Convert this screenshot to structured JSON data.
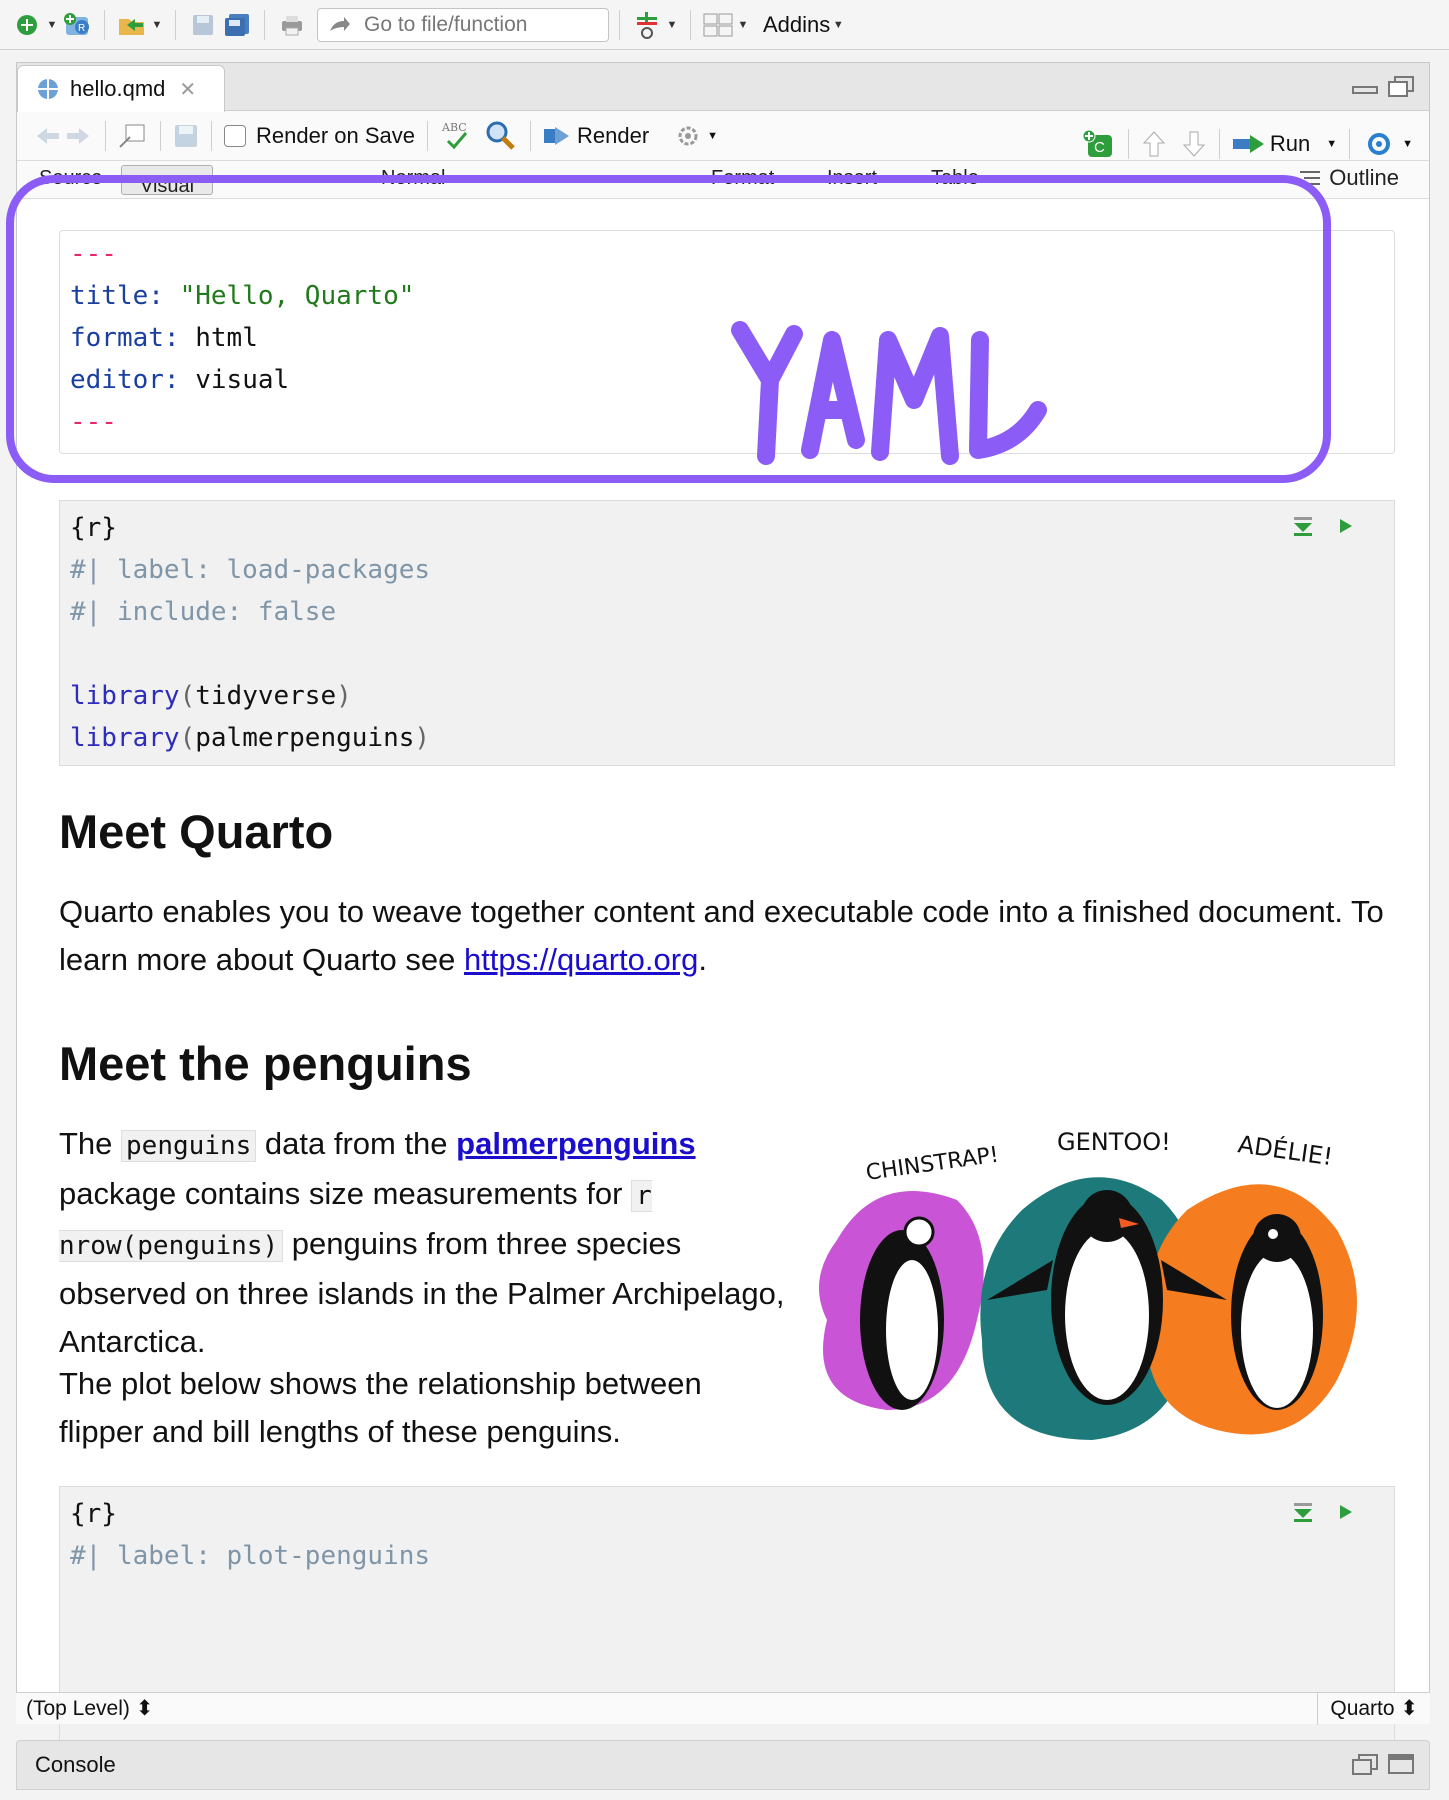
{
  "topbar": {
    "goto_placeholder": "Go to file/function",
    "addins_label": "Addins"
  },
  "editor": {
    "tab_filename": "hello.qmd",
    "toolbar": {
      "render_on_save": "Render on Save",
      "render_label": "Render",
      "run_label": "Run"
    },
    "format_bar": {
      "source": "Source",
      "visual": "Visual",
      "normal": "Normal",
      "format": "Format",
      "insert": "Insert",
      "table": "Table",
      "outline": "Outline"
    }
  },
  "yaml": {
    "dash_open": "---",
    "title_key": "title:",
    "title_val": "\"Hello, Quarto\"",
    "format_key": "format:",
    "format_val": "html",
    "editor_key": "editor:",
    "editor_val": "visual",
    "dash_close": "---"
  },
  "annotation": {
    "label": "YAML",
    "color": "#8b5cf6"
  },
  "chunk1": {
    "header": "{r}",
    "line1": "#| label: load-packages",
    "line2": "#| include: false",
    "lib": "library",
    "arg1": "tidyverse",
    "arg2": "palmerpenguins"
  },
  "section1": {
    "heading": "Meet Quarto",
    "text_before": "Quarto enables you to weave together content and executable code into a finished document. To learn more about Quarto see ",
    "link": "https://quarto.org",
    "text_after": "."
  },
  "section2": {
    "heading": "Meet the penguins",
    "p1_a": "The ",
    "p1_code1": "penguins",
    "p1_b": " data from the ",
    "p1_link": "palmerpenguins",
    "p1_c": " package contains size measurements for ",
    "p1_code2": "r nrow(penguins)",
    "p1_d": " penguins from three species observed on three islands in the Palmer Archipelago, Antarctica.",
    "p2": "The plot below shows the relationship between flipper and bill lengths of these penguins."
  },
  "penguin_labels": [
    "CHINSTRAP!",
    "GENTOO!",
    "ADÉLIE!"
  ],
  "chunk2": {
    "header": "{r}",
    "line1": "#| label: plot-penguins"
  },
  "statusbar": {
    "left": "(Top Level) ⬍",
    "right": "Quarto ⬍"
  },
  "console": {
    "label": "Console"
  }
}
